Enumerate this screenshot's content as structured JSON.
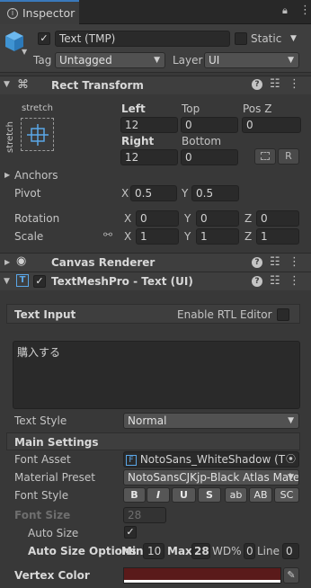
{
  "window": {
    "tab_title": "Inspector"
  },
  "gameobject": {
    "name": "Text (TMP)",
    "static_label": "Static",
    "tag_label": "Tag",
    "tag_value": "Untagged",
    "layer_label": "Layer",
    "layer_value": "UI"
  },
  "rect_transform": {
    "title": "Rect Transform",
    "anchor_preset_top": "stretch",
    "anchor_preset_side": "stretch",
    "left_label": "Left",
    "left_value": "12",
    "top_label": "Top",
    "top_value": "0",
    "posz_label": "Pos Z",
    "posz_value": "0",
    "right_label": "Right",
    "right_value": "12",
    "bottom_label": "Bottom",
    "bottom_value": "0",
    "r_button": "R",
    "anchors_label": "Anchors",
    "pivot_label": "Pivot",
    "pivot_x": "0.5",
    "pivot_y": "0.5",
    "rotation_label": "Rotation",
    "rot_x": "0",
    "rot_y": "0",
    "rot_z": "0",
    "scale_label": "Scale",
    "scale_x": "1",
    "scale_y": "1",
    "scale_z": "1",
    "x": "X",
    "y": "Y",
    "z": "Z"
  },
  "canvas_renderer": {
    "title": "Canvas Renderer"
  },
  "tmp": {
    "title": "TextMeshPro - Text (UI)",
    "text_input_label": "Text Input",
    "rtl_label": "Enable RTL Editor",
    "text_value": "購入する",
    "text_style_label": "Text Style",
    "text_style_value": "Normal",
    "main_settings": "Main Settings",
    "font_asset_label": "Font Asset",
    "font_asset_value": "NotoSans_WhiteShadow (TM",
    "material_preset_label": "Material Preset",
    "material_preset_value": "NotoSansCJKjp-Black Atlas Mater",
    "font_style_label": "Font Style",
    "font_style_buttons": [
      "B",
      "I",
      "U",
      "S",
      "ab",
      "AB",
      "SC"
    ],
    "font_size_label": "Font Size",
    "font_size_value": "28",
    "auto_size_label": "Auto Size",
    "auto_size_options_label": "Auto Size Options",
    "min_label": "Min",
    "min_value": "10",
    "max_label": "Max",
    "max_value": "28",
    "wd_label": "WD%",
    "wd_value": "0",
    "line_label": "Line",
    "line_value": "0",
    "vertex_color_label": "Vertex Color",
    "vertex_color": "#5a1a1a"
  }
}
